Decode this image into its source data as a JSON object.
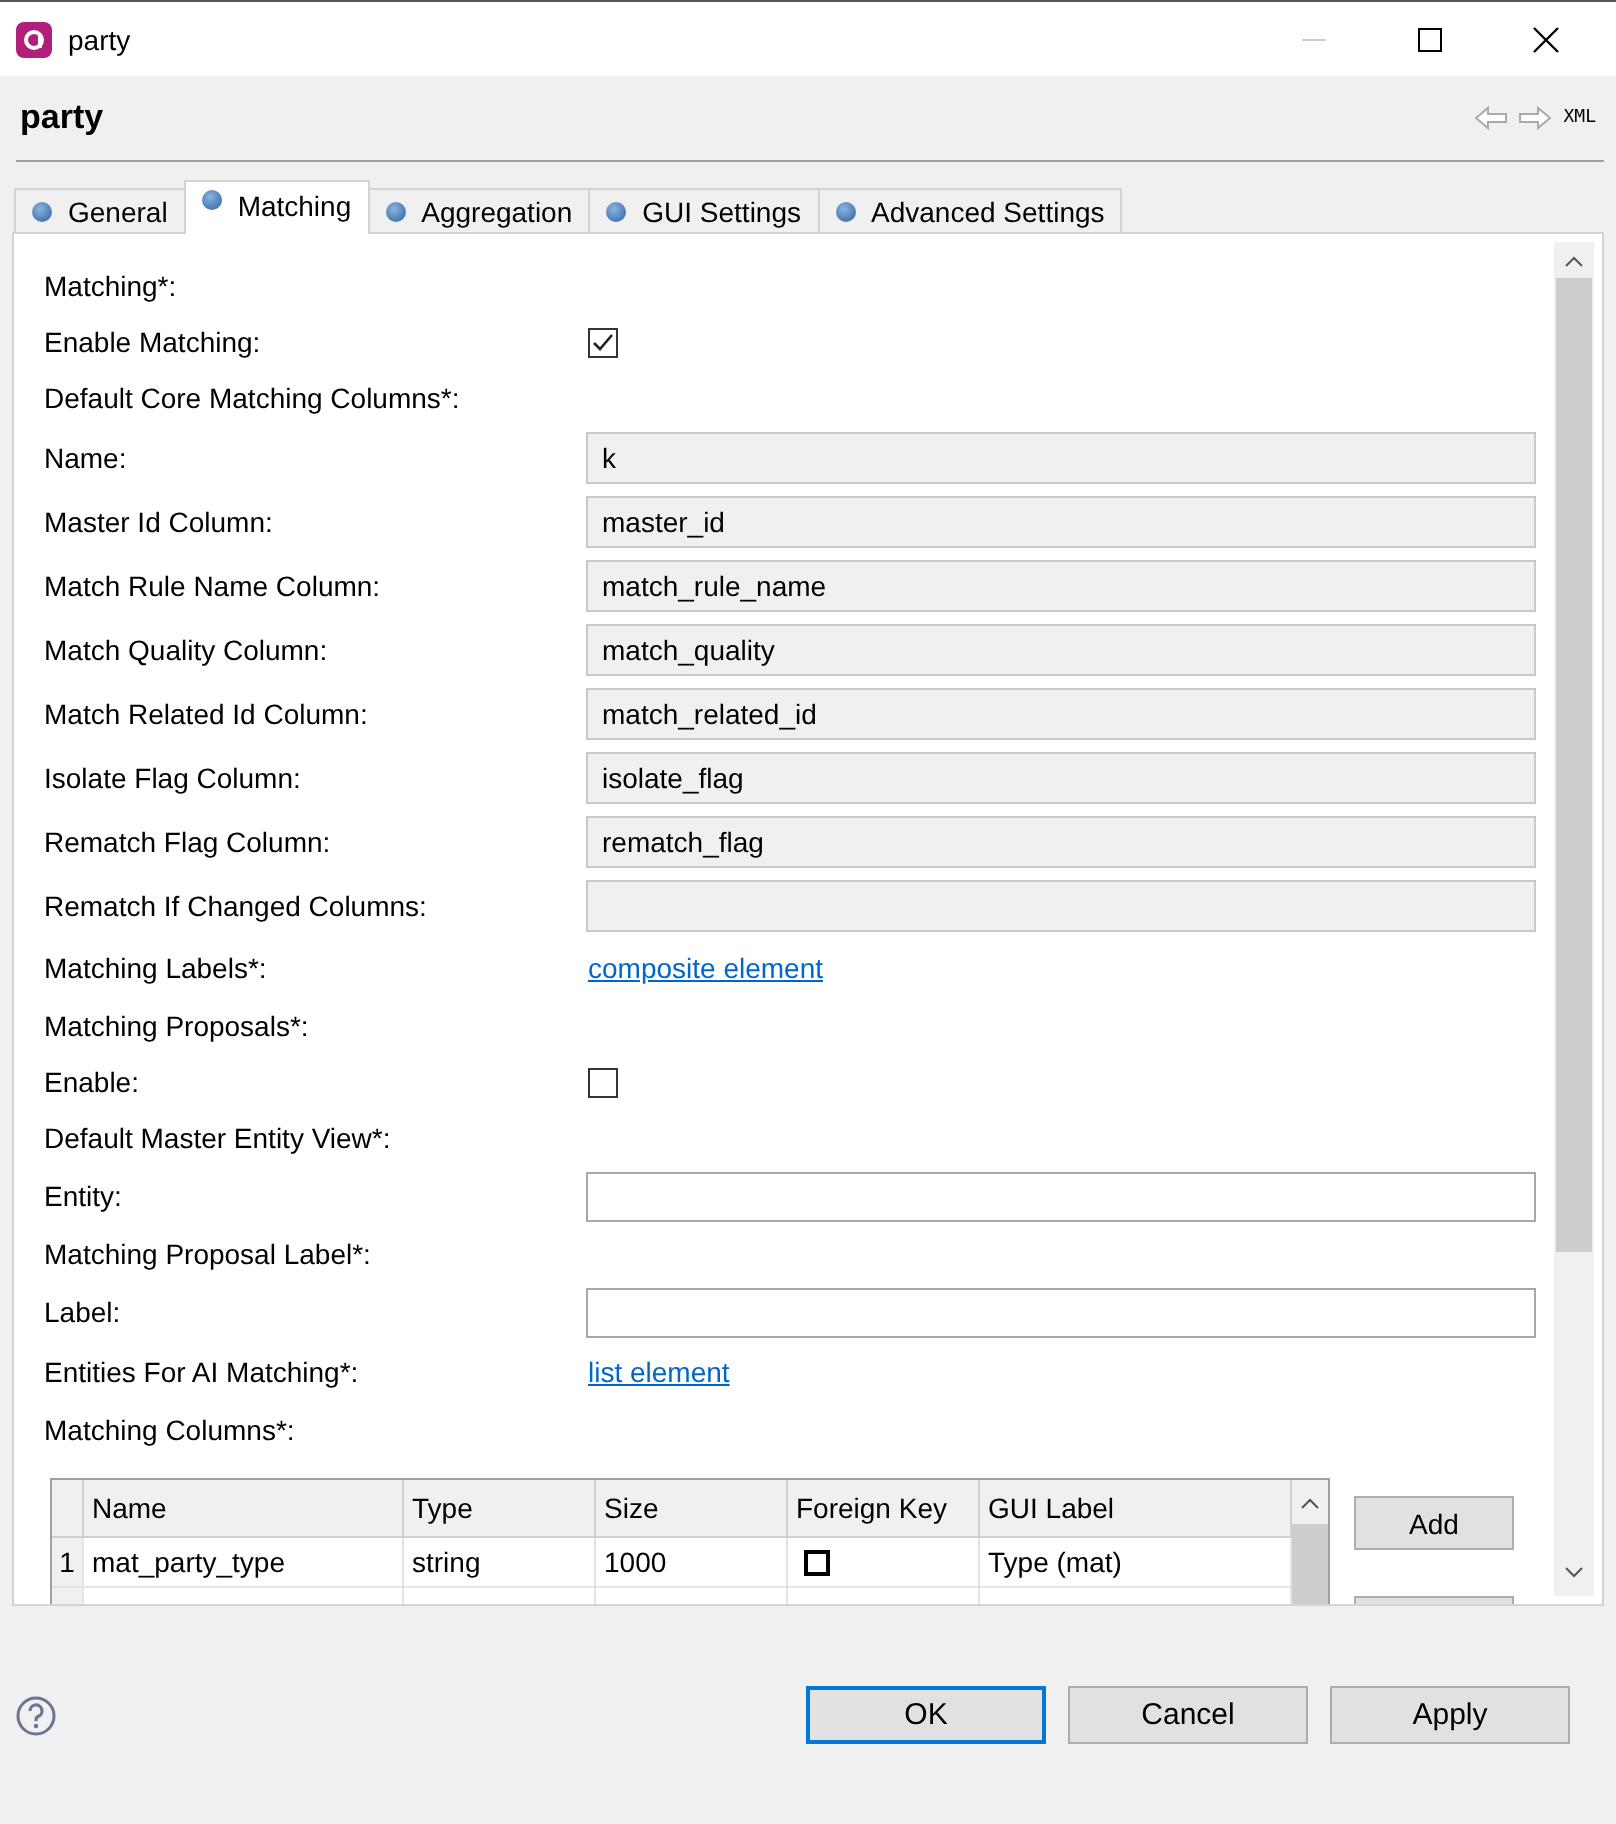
{
  "window": {
    "title": "party"
  },
  "editor": {
    "title": "party",
    "toolbar": [
      "XML"
    ]
  },
  "tabs": [
    {
      "label": "General",
      "selected": false
    },
    {
      "label": "Matching",
      "selected": true
    },
    {
      "label": "Aggregation",
      "selected": false
    },
    {
      "label": "GUI Settings",
      "selected": false
    },
    {
      "label": "Advanced Settings",
      "selected": false
    }
  ],
  "form": [
    {
      "kind": "heading",
      "label": "Matching*:"
    },
    {
      "kind": "checkbox",
      "label": "Enable Matching:",
      "checked": true
    },
    {
      "kind": "heading",
      "label": "Default Core Matching Columns*:"
    },
    {
      "kind": "field",
      "label": "Name:",
      "value": "k"
    },
    {
      "kind": "field",
      "label": "Master Id Column:",
      "value": "master_id"
    },
    {
      "kind": "field",
      "label": "Match Rule Name Column:",
      "value": "match_rule_name"
    },
    {
      "kind": "field",
      "label": "Match Quality Column:",
      "value": "match_quality"
    },
    {
      "kind": "field",
      "label": "Match Related Id Column:",
      "value": "match_related_id"
    },
    {
      "kind": "field",
      "label": "Isolate Flag Column:",
      "value": "isolate_flag"
    },
    {
      "kind": "field",
      "label": "Rematch Flag Column:",
      "value": "rematch_flag"
    },
    {
      "kind": "field",
      "label": "Rematch If Changed Columns:"
    },
    {
      "kind": "link",
      "label": "Matching Labels*:",
      "value": "composite element"
    },
    {
      "kind": "heading",
      "label": "Matching Proposals*:"
    },
    {
      "kind": "checkbox",
      "label": "Enable:",
      "checked": false
    },
    {
      "kind": "heading",
      "label": "Default Master Entity View*:"
    },
    {
      "kind": "input",
      "label": "Entity:"
    },
    {
      "kind": "heading",
      "label": "Matching Proposal Label*:"
    },
    {
      "kind": "input",
      "label": "Label:"
    },
    {
      "kind": "link",
      "label": "Entities For AI Matching*:",
      "value": "list element"
    },
    {
      "kind": "heading",
      "label": "Matching Columns*:"
    }
  ],
  "table": {
    "columns": [
      "Name",
      "Type",
      "Size",
      "Foreign Key",
      "GUI Label"
    ],
    "rows": [
      {
        "number": "1",
        "name": "mat_party_type",
        "type": "string",
        "size": "1000",
        "foreign_key": false,
        "gui_label": "Type (mat)"
      }
    ],
    "buttons": [
      "Add"
    ]
  },
  "buttons": [
    {
      "label": "OK",
      "default": true
    },
    {
      "label": "Cancel",
      "default": false
    },
    {
      "label": "Apply",
      "default": false
    }
  ]
}
